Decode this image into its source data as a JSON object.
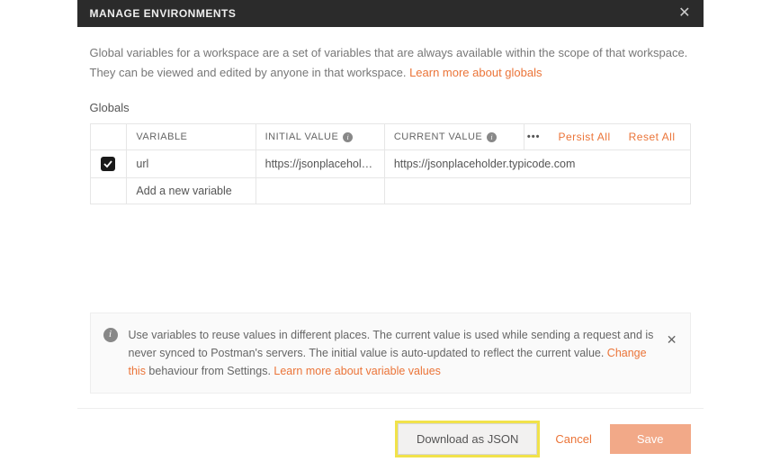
{
  "header": {
    "title": "MANAGE ENVIRONMENTS"
  },
  "intro": {
    "text_a": "Global variables for a workspace are a set of variables that are always available within the scope of that workspace. They can be viewed and edited by anyone in that workspace. ",
    "link": "Learn more about globals"
  },
  "section_title": "Globals",
  "table": {
    "headers": {
      "variable": "VARIABLE",
      "initial": "INITIAL VALUE",
      "current": "CURRENT VALUE"
    },
    "actions": {
      "persist": "Persist All",
      "reset": "Reset All"
    },
    "rows": [
      {
        "checked": true,
        "variable": "url",
        "initial": "https://jsonplacehold...",
        "current": "https://jsonplaceholder.typicode.com"
      }
    ],
    "new_row_placeholder": "Add a new variable"
  },
  "banner": {
    "text_a": "Use variables to reuse values in different places. The current value is used while sending a request and is never synced to Postman's servers. The initial value is auto-updated to reflect the current value. ",
    "link_a": "Change this",
    "text_b": " behaviour from Settings. ",
    "link_b": "Learn more about variable values"
  },
  "footer": {
    "download": "Download as JSON",
    "cancel": "Cancel",
    "save": "Save"
  }
}
